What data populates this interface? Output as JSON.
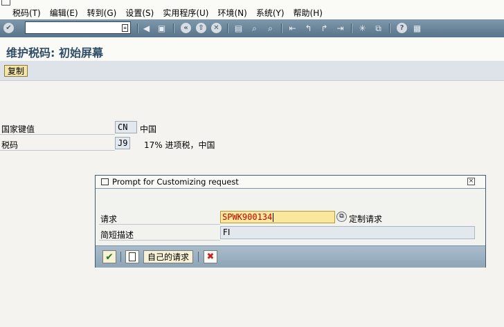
{
  "menu": {
    "items": [
      "税码(T)",
      "编辑(E)",
      "转到(G)",
      "设置(S)",
      "实用程序(U)",
      "环境(N)",
      "系统(Y)",
      "帮助(H)"
    ]
  },
  "toolbar": {
    "command_value": "",
    "icons": [
      "enter-icon",
      "history-icon",
      "back-icon",
      "save-icon",
      "previous-icon",
      "exit-icon",
      "cancel-icon",
      "print-icon",
      "find-icon",
      "find-next-icon",
      "first-page-icon",
      "previous-page-icon",
      "next-page-icon",
      "last-page-icon",
      "new-session-icon",
      "shortcut-icon",
      "help-icon",
      "layout-icon"
    ]
  },
  "title": "维护税码: 初始屏幕",
  "app_toolbar": {
    "copy_label": "复制"
  },
  "fields": {
    "country_label": "国家键值",
    "country_value": "CN",
    "country_desc": "中国",
    "tax_code_label": "税码",
    "tax_code_value": "J9",
    "tax_code_desc": "17% 进项税，中国"
  },
  "dialog": {
    "title": "Prompt for Customizing request",
    "request_label": "请求",
    "request_value": "SPWK900134",
    "request_type": "定制请求",
    "short_desc_label": "简短描述",
    "short_desc_value": "FI",
    "own_requests_label": "自己的请求"
  },
  "colors": {
    "toolbar_bg": "#6b879c",
    "title_text": "#2f4d67",
    "request_input_bg": "#fbe79b",
    "request_text": "#c00000",
    "cancel_red": "#cc1f1f"
  }
}
